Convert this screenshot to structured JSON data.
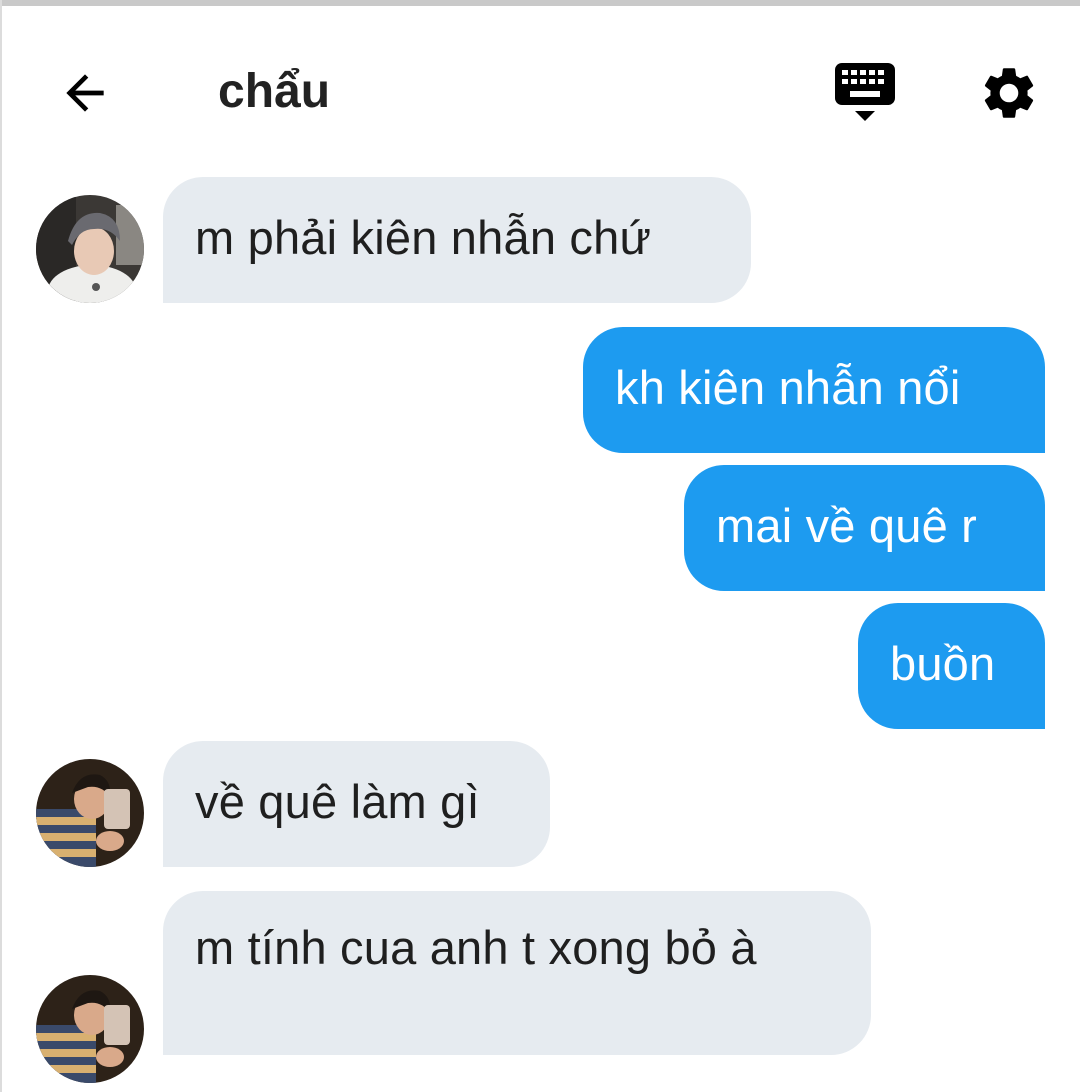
{
  "header": {
    "title": "chẩu",
    "back_icon": "arrow-left-icon",
    "keyboard_icon": "keyboard-hide-icon",
    "settings_icon": "gear-icon"
  },
  "messages": [
    {
      "direction": "incoming",
      "text": "m phải kiên nhẫn chứ"
    },
    {
      "direction": "outgoing",
      "text": "kh kiên nhẫn nổi"
    },
    {
      "direction": "outgoing",
      "text": "mai về quê r"
    },
    {
      "direction": "outgoing",
      "text": "buồn"
    },
    {
      "direction": "incoming",
      "text": "về quê làm gì"
    },
    {
      "direction": "incoming",
      "text": "m tính cua anh t xong bỏ à"
    }
  ],
  "colors": {
    "incoming_bubble": "#e6ebf0",
    "outgoing_bubble": "#1d9bf0",
    "title_text": "#222222"
  }
}
